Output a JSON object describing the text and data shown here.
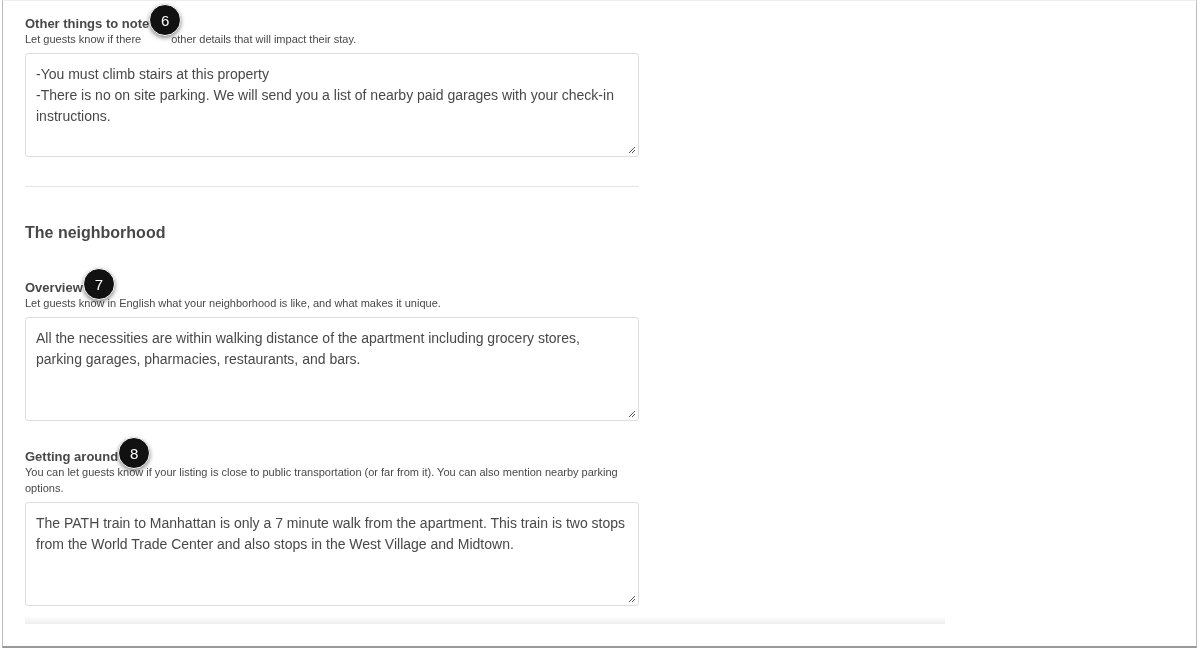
{
  "sections": [
    {
      "fields": [
        {
          "title": "Other things to note",
          "badge": "6",
          "hint": [
            "Let guests know if there",
            "other details that will impact their stay."
          ],
          "value": "-You must climb stairs at this property\n-There is no on site parking. We will send you a list of nearby paid garages with your check-in instructions."
        }
      ]
    },
    {
      "heading": "The neighborhood",
      "fields": [
        {
          "title": "Overview",
          "badge": "7",
          "hint": [
            "Let guests know in English what your neighborhood is like, and what makes it unique."
          ],
          "value": "All the necessities are within walking distance of the apartment including grocery stores, parking garages, pharmacies, restaurants, and bars."
        },
        {
          "title": "Getting around",
          "badge": "8",
          "hint": [
            "You can let guests know if your listing is close to public transportation (or far from it). You can also mention nearby parking options."
          ],
          "value": "The PATH train to Manhattan is only a 7 minute walk from the apartment. This train is two stops from the World Trade Center and also stops in the West Village and Midtown."
        }
      ]
    }
  ]
}
